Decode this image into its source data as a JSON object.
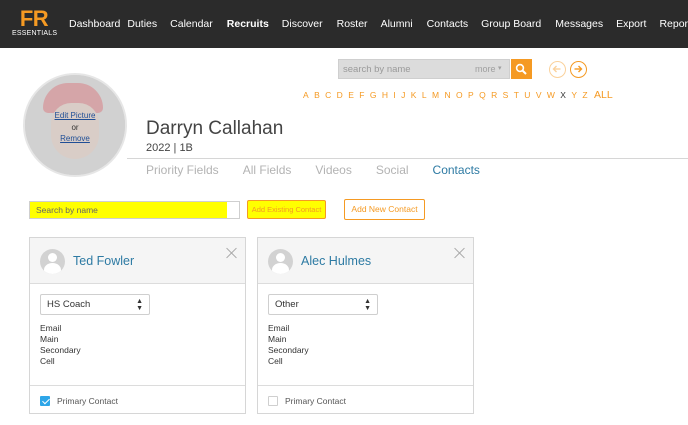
{
  "brand": {
    "logo": "FR",
    "logo_sub": "ESSENTIALS",
    "accent_color": "#f59a23"
  },
  "nav": {
    "items": [
      {
        "label": "Dashboard",
        "active": false
      },
      {
        "label": "Duties",
        "active": false
      },
      {
        "label": "Calendar",
        "active": false
      },
      {
        "label": "Recruits",
        "active": true
      },
      {
        "label": "Discover",
        "active": false
      },
      {
        "label": "Roster",
        "active": false
      },
      {
        "label": "Alumni",
        "active": false
      },
      {
        "label": "Contacts",
        "active": false
      },
      {
        "label": "Group Board",
        "active": false
      },
      {
        "label": "Messages",
        "active": false
      },
      {
        "label": "Export",
        "active": false
      },
      {
        "label": "Reporting",
        "active": false
      }
    ]
  },
  "search": {
    "placeholder": "search by name",
    "more_label": "more",
    "more_caret": "▾"
  },
  "alphabet": {
    "letters": [
      "A",
      "B",
      "C",
      "D",
      "E",
      "F",
      "G",
      "H",
      "I",
      "J",
      "K",
      "L",
      "M",
      "N",
      "O",
      "P",
      "Q",
      "R",
      "S",
      "T",
      "U",
      "V",
      "W",
      "X",
      "Y",
      "Z"
    ],
    "dim_letters": [
      "X"
    ],
    "all_label": "ALL"
  },
  "profile": {
    "edit_picture": "Edit Picture",
    "or_label": "or",
    "remove_label": "Remove",
    "name": "Darryn Callahan",
    "meta": "2022 | 1B"
  },
  "tabs": [
    {
      "label": "Priority Fields",
      "active": false
    },
    {
      "label": "All Fields",
      "active": false
    },
    {
      "label": "Videos",
      "active": false
    },
    {
      "label": "Social",
      "active": false
    },
    {
      "label": "Contacts",
      "active": true
    }
  ],
  "contact_search": {
    "placeholder": "Search by name",
    "add_existing_label": "Add Existing Contact",
    "add_new_label": "Add New Contact"
  },
  "contacts": [
    {
      "name": "Ted Fowler",
      "type": "HS Coach",
      "fields": [
        "Email",
        "Main",
        "Secondary",
        "Cell"
      ],
      "primary_label": "Primary Contact",
      "primary": true
    },
    {
      "name": "Alec Hulmes",
      "type": "Other",
      "fields": [
        "Email",
        "Main",
        "Secondary",
        "Cell"
      ],
      "primary_label": "Primary Contact",
      "primary": false
    }
  ]
}
